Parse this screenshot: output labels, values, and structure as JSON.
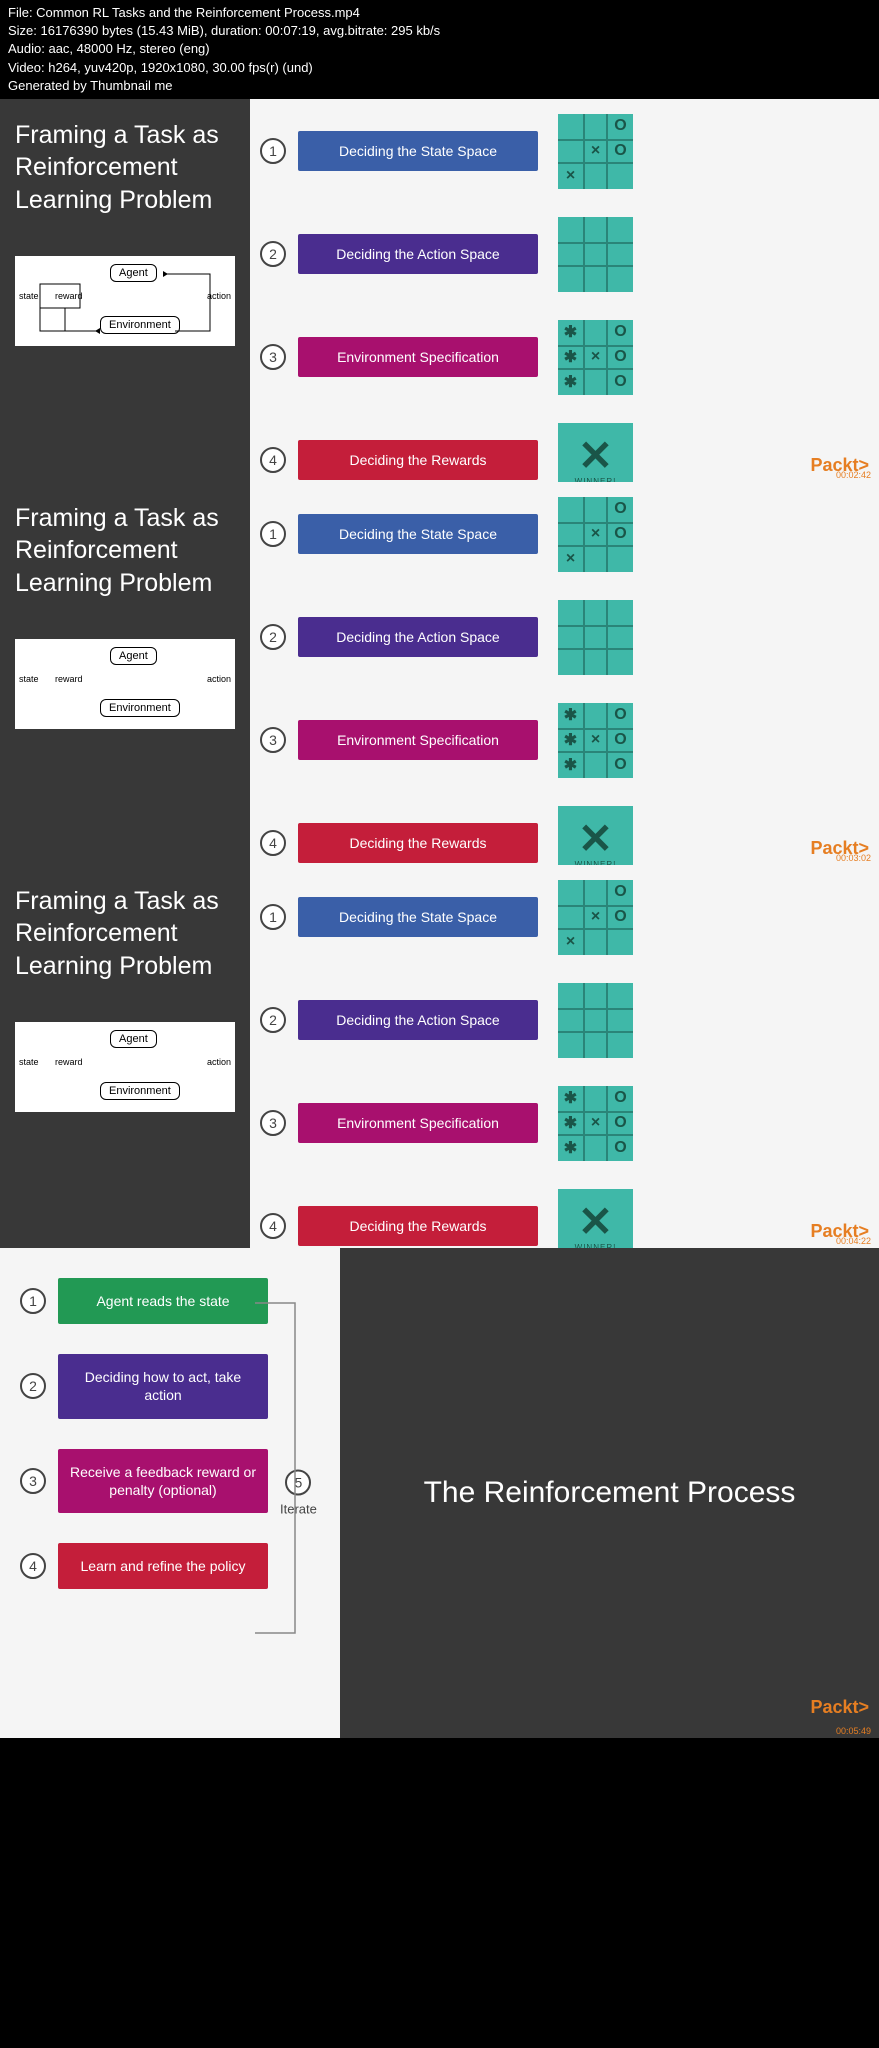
{
  "meta": {
    "file": "File: Common RL Tasks and the Reinforcement Process.mp4",
    "size": "Size: 16176390 bytes (15.43 MiB), duration: 00:07:19, avg.bitrate: 295 kb/s",
    "audio": "Audio: aac, 48000 Hz, stereo (eng)",
    "video": "Video: h264, yuv420p, 1920x1080, 30.00 fps(r) (und)",
    "gen": "Generated by Thumbnail me"
  },
  "f": {
    "title": "Framing a Task as Reinforcement Learning Problem",
    "dia": {
      "agent": "Agent",
      "env": "Environment",
      "state": "state",
      "reward": "reward",
      "action": "action"
    },
    "s1": "Deciding the State Space",
    "s2": "Deciding the Action Space",
    "s3": "Environment Specification",
    "s4": "Deciding the Rewards",
    "win": "WINNER!"
  },
  "brand": "Packt>",
  "ts": [
    "00:02:42",
    "00:03:02",
    "00:04:22",
    "00:05:49"
  ],
  "p": {
    "title": "The Reinforcement Process",
    "s1": "Agent reads the state",
    "s2": "Deciding how to act, take action",
    "s3": "Receive a feedback reward or penalty (optional)",
    "s4": "Learn and refine the policy",
    "s5": "Iterate"
  }
}
